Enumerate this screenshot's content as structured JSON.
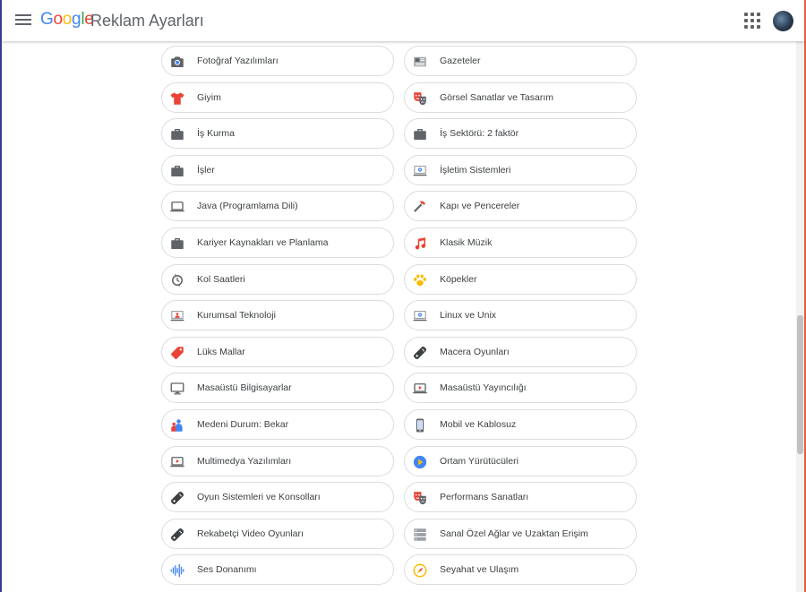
{
  "header": {
    "logo_text": "Google",
    "title": "Reklam Ayarları"
  },
  "icons": {
    "menu": "menu-icon",
    "apps": "apps-grid-icon",
    "avatar": "avatar"
  },
  "topics": [
    {
      "label": "Fotoğraf Yazılımları",
      "icon": "camera-icon"
    },
    {
      "label": "Gazeteler",
      "icon": "newspaper-icon"
    },
    {
      "label": "Giyim",
      "icon": "tshirt-icon"
    },
    {
      "label": "Görsel Sanatlar ve Tasarım",
      "icon": "theater-masks-icon"
    },
    {
      "label": "İş Kurma",
      "icon": "briefcase-icon"
    },
    {
      "label": "İş Sektörü: 2 faktör",
      "icon": "briefcase-icon"
    },
    {
      "label": "İşler",
      "icon": "briefcase-icon"
    },
    {
      "label": "İşletim Sistemleri",
      "icon": "computer-gear-icon"
    },
    {
      "label": "Java (Programlama Dili)",
      "icon": "laptop-icon"
    },
    {
      "label": "Kapı ve Pencereler",
      "icon": "hammer-icon"
    },
    {
      "label": "Kariyer Kaynakları ve Planlama",
      "icon": "briefcase-icon"
    },
    {
      "label": "Klasik Müzik",
      "icon": "music-note-icon"
    },
    {
      "label": "Kol Saatleri",
      "icon": "watch-icon"
    },
    {
      "label": "Köpekler",
      "icon": "paw-icon"
    },
    {
      "label": "Kurumsal Teknoloji",
      "icon": "computer-person-icon"
    },
    {
      "label": "Linux ve Unix",
      "icon": "computer-gear-icon"
    },
    {
      "label": "Lüks Mallar",
      "icon": "tag-icon"
    },
    {
      "label": "Macera Oyunları",
      "icon": "gamepad-icon"
    },
    {
      "label": "Masaüstü Bilgisayarlar",
      "icon": "monitor-icon"
    },
    {
      "label": "Masaüstü Yayıncılığı",
      "icon": "laptop-play-icon"
    },
    {
      "label": "Medeni Durum: Bekar",
      "icon": "person-icon"
    },
    {
      "label": "Mobil ve Kablosuz",
      "icon": "phone-icon"
    },
    {
      "label": "Multimedya Yazılımları",
      "icon": "laptop-play-icon"
    },
    {
      "label": "Ortam Yürütücüleri",
      "icon": "play-circle-icon"
    },
    {
      "label": "Oyun Sistemleri ve Konsolları",
      "icon": "gamepad-icon"
    },
    {
      "label": "Performans Sanatları",
      "icon": "theater-masks-icon"
    },
    {
      "label": "Rekabetçi Video Oyunları",
      "icon": "gamepad-icon"
    },
    {
      "label": "Sanal Özel Ağlar ve Uzaktan Erişim",
      "icon": "server-icon"
    },
    {
      "label": "Ses Donanımı",
      "icon": "soundwave-icon"
    },
    {
      "label": "Seyahat ve Ulaşım",
      "icon": "compass-icon"
    }
  ]
}
